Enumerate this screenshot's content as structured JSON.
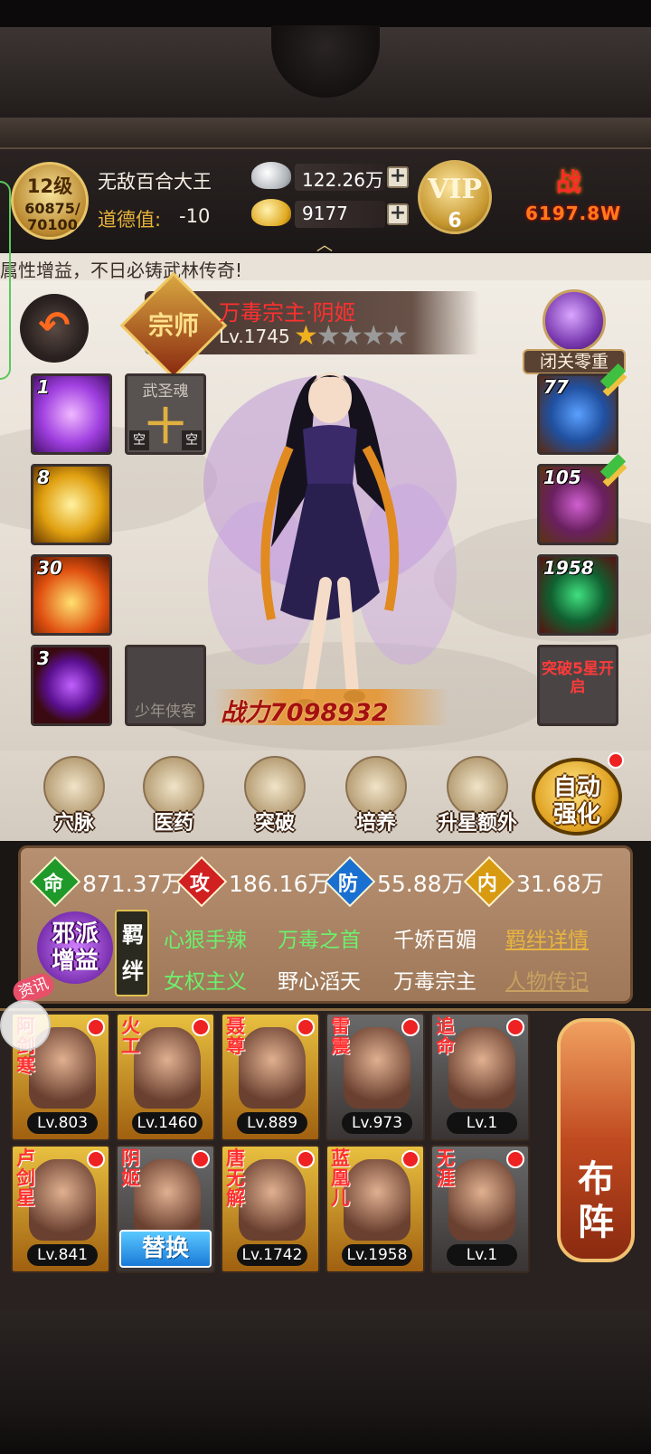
{
  "header": {
    "level": "12级",
    "exp": "60875/\n70100",
    "player_name": "无敌百合大王",
    "morality_label": "道德值:",
    "morality_value": "-10",
    "silver": "122.26万",
    "gold": "9177",
    "vip_label": "VIP",
    "vip_level": "6",
    "power_label": "战",
    "power_value": "6197.8W"
  },
  "ticker": "属性增益，不日必铸武林传奇!",
  "hero": {
    "seal": "宗师",
    "name": "万毒宗主·阴姬",
    "level": "Lv.1745",
    "stars_on": 1,
    "stars_total": 5,
    "retreat_label": "闭关零重",
    "combat_power": "战力7098932"
  },
  "left_slots": [
    {
      "num": "1",
      "type": "skill-purple"
    },
    {
      "num": "8",
      "type": "skill-gold"
    },
    {
      "num": "30",
      "type": "skill-fire"
    },
    {
      "num": "3",
      "type": "skill-orb"
    }
  ],
  "soul_slot": {
    "caption": "武圣魂",
    "glyph": "十",
    "empty": "空"
  },
  "youth_slot": {
    "caption": "少年侠客"
  },
  "right_slots": [
    {
      "num": "77",
      "type": "equip-weapon"
    },
    {
      "num": "105",
      "type": "equip-armor"
    },
    {
      "num": "1958",
      "type": "equip-book"
    }
  ],
  "breakthrough": "突破5星开启",
  "actions": [
    {
      "label": "穴脉",
      "icon": "meridian-icon"
    },
    {
      "label": "医药",
      "icon": "herb-icon"
    },
    {
      "label": "突破",
      "icon": "breakthrough-icon"
    },
    {
      "label": "培养",
      "icon": "scroll-icon"
    },
    {
      "label": "升星额外",
      "icon": "star-up-icon"
    }
  ],
  "auto_strengthen": "自动强化",
  "stats": [
    {
      "glyph": "命",
      "value": "871.37万",
      "color": "#1f9a2a"
    },
    {
      "glyph": "攻",
      "value": "186.16万",
      "color": "#d02020"
    },
    {
      "glyph": "防",
      "value": "55.88万",
      "color": "#1a70d0"
    },
    {
      "glyph": "内",
      "value": "31.68万",
      "color": "#d89a10"
    }
  ],
  "faction": "邪派增益",
  "bond_tag": "羁绊",
  "bonds": [
    {
      "text": "心狠手辣",
      "state": "active"
    },
    {
      "text": "万毒之首",
      "state": "active"
    },
    {
      "text": "千娇百媚",
      "state": "inactive"
    },
    {
      "text": "羁绊详情",
      "state": "link"
    },
    {
      "text": "女权主义",
      "state": "active"
    },
    {
      "text": "野心滔天",
      "state": "inactive"
    },
    {
      "text": "万毒宗主",
      "state": "inactive"
    },
    {
      "text": "人物传记",
      "state": "link-dim"
    }
  ],
  "news_badge": "资讯",
  "roster": [
    {
      "name": "阿剑寒",
      "level": "Lv.803",
      "theme": "yellow"
    },
    {
      "name": "火工",
      "level": "Lv.1460",
      "theme": "yellow"
    },
    {
      "name": "聂尊",
      "level": "Lv.889",
      "theme": "yellow"
    },
    {
      "name": "雷震",
      "level": "Lv.973",
      "theme": "dark"
    },
    {
      "name": "追命",
      "level": "Lv.1",
      "theme": "dark"
    },
    {
      "name": "卢剑星",
      "level": "Lv.841",
      "theme": "yellow"
    },
    {
      "name": "阴姬",
      "level": "",
      "theme": "dark",
      "swap": "替换"
    },
    {
      "name": "唐无解",
      "level": "Lv.1742",
      "theme": "yellow"
    },
    {
      "name": "蓝凰儿",
      "level": "Lv.1958",
      "theme": "yellow"
    },
    {
      "name": "无涯",
      "level": "Lv.1",
      "theme": "dark"
    }
  ],
  "formation": "布阵"
}
